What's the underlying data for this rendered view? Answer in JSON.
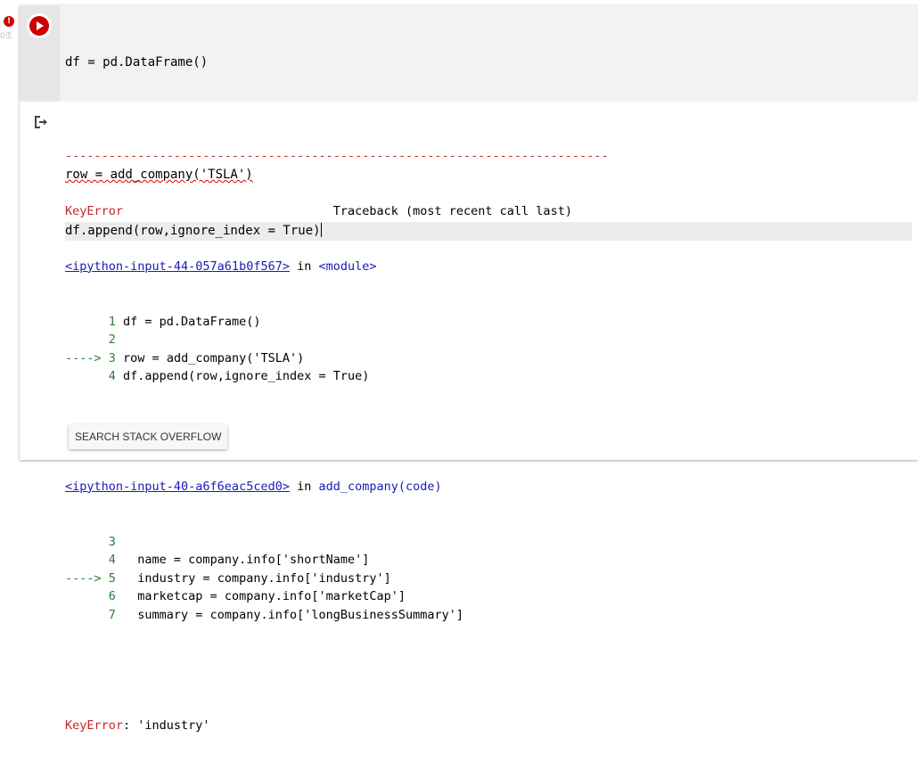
{
  "status": {
    "error_badge": "!",
    "exec_time": "0초"
  },
  "input": {
    "lines": [
      "df = pd.DataFrame()",
      "",
      "row = add_company('TSLA')",
      "df.append(row,ignore_index = True)"
    ]
  },
  "output": {
    "separator": "---------------------------------------------------------------------------",
    "error_name": "KeyError",
    "traceback_label": "Traceback (most recent call last)",
    "frame1": {
      "link": "<ipython-input-44-057a61b0f567>",
      "in_text": "in",
      "scope": "<module>",
      "lines": [
        {
          "arrow": "     ",
          "num": " 1",
          "code": "df = pd.DataFrame()"
        },
        {
          "arrow": "     ",
          "num": " 2",
          "code": ""
        },
        {
          "arrow": "----> ",
          "num": "3",
          "code": "row = add_company('TSLA')"
        },
        {
          "arrow": "     ",
          "num": " 4",
          "code": "df.append(row,ignore_index = True)"
        }
      ]
    },
    "frame2": {
      "link": "<ipython-input-40-a6f6eac5ced0>",
      "in_text": "in",
      "scope": "add_company(code)",
      "lines": [
        {
          "arrow": "     ",
          "num": " 3",
          "code": ""
        },
        {
          "arrow": "     ",
          "num": " 4",
          "code": "  name = company.info['shortName']"
        },
        {
          "arrow": "----> ",
          "num": "5",
          "code": "  industry = company.info['industry']"
        },
        {
          "arrow": "     ",
          "num": " 6",
          "code": "  marketcap = company.info['marketCap']"
        },
        {
          "arrow": "     ",
          "num": " 7",
          "code": "  summary = company.info['longBusinessSummary']"
        }
      ]
    },
    "final_error_name": "KeyError",
    "final_error_msg": ": 'industry'",
    "search_button": "SEARCH STACK OVERFLOW"
  }
}
